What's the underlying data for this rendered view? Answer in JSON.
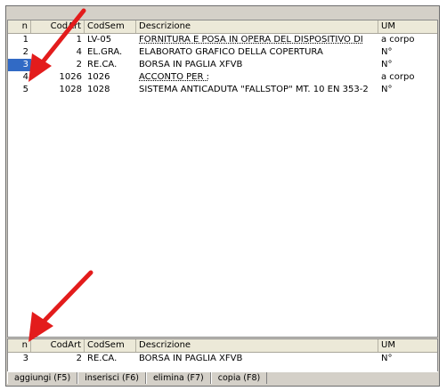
{
  "top_grid": {
    "columns": [
      "n",
      "CodArt",
      "CodSem",
      "Descrizione",
      "UM"
    ],
    "rows": [
      {
        "n": "1",
        "codart": "1",
        "codsem": "LV-05",
        "descrizione": "FORNITURA E POSA IN OPERA DEL DISPOSITIVO DI",
        "um": "a corpo"
      },
      {
        "n": "2",
        "codart": "4",
        "codsem": "EL.GRA.",
        "descrizione": "ELABORATO GRAFICO DELLA COPERTURA",
        "um": "N°"
      },
      {
        "n": "3",
        "codart": "2",
        "codsem": "RE.CA.",
        "descrizione": "BORSA IN PAGLIA XFVB",
        "um": "N°"
      },
      {
        "n": "4",
        "codart": "1026",
        "codsem": "1026",
        "descrizione": "ACCONTO PER :",
        "um": "a corpo"
      },
      {
        "n": "5",
        "codart": "1028",
        "codsem": "1028",
        "descrizione": "SISTEMA ANTICADUTA \"FALLSTOP\" MT. 10 EN 353-2",
        "um": "N°"
      }
    ]
  },
  "bottom_grid": {
    "columns": [
      "n",
      "CodArt",
      "CodSem",
      "Descrizione",
      "UM"
    ],
    "rows": [
      {
        "n": "3",
        "codart": "2",
        "codsem": "RE.CA.",
        "descrizione": "BORSA IN PAGLIA XFVB",
        "um": "N°"
      }
    ]
  },
  "toolbar": {
    "add": "aggiungi (F5)",
    "insert": "inserisci (F6)",
    "delete": "elimina (F7)",
    "copy": "copia (F8)"
  },
  "colors": {
    "arrow": "#e31c1c",
    "selection": "#316ac5"
  }
}
